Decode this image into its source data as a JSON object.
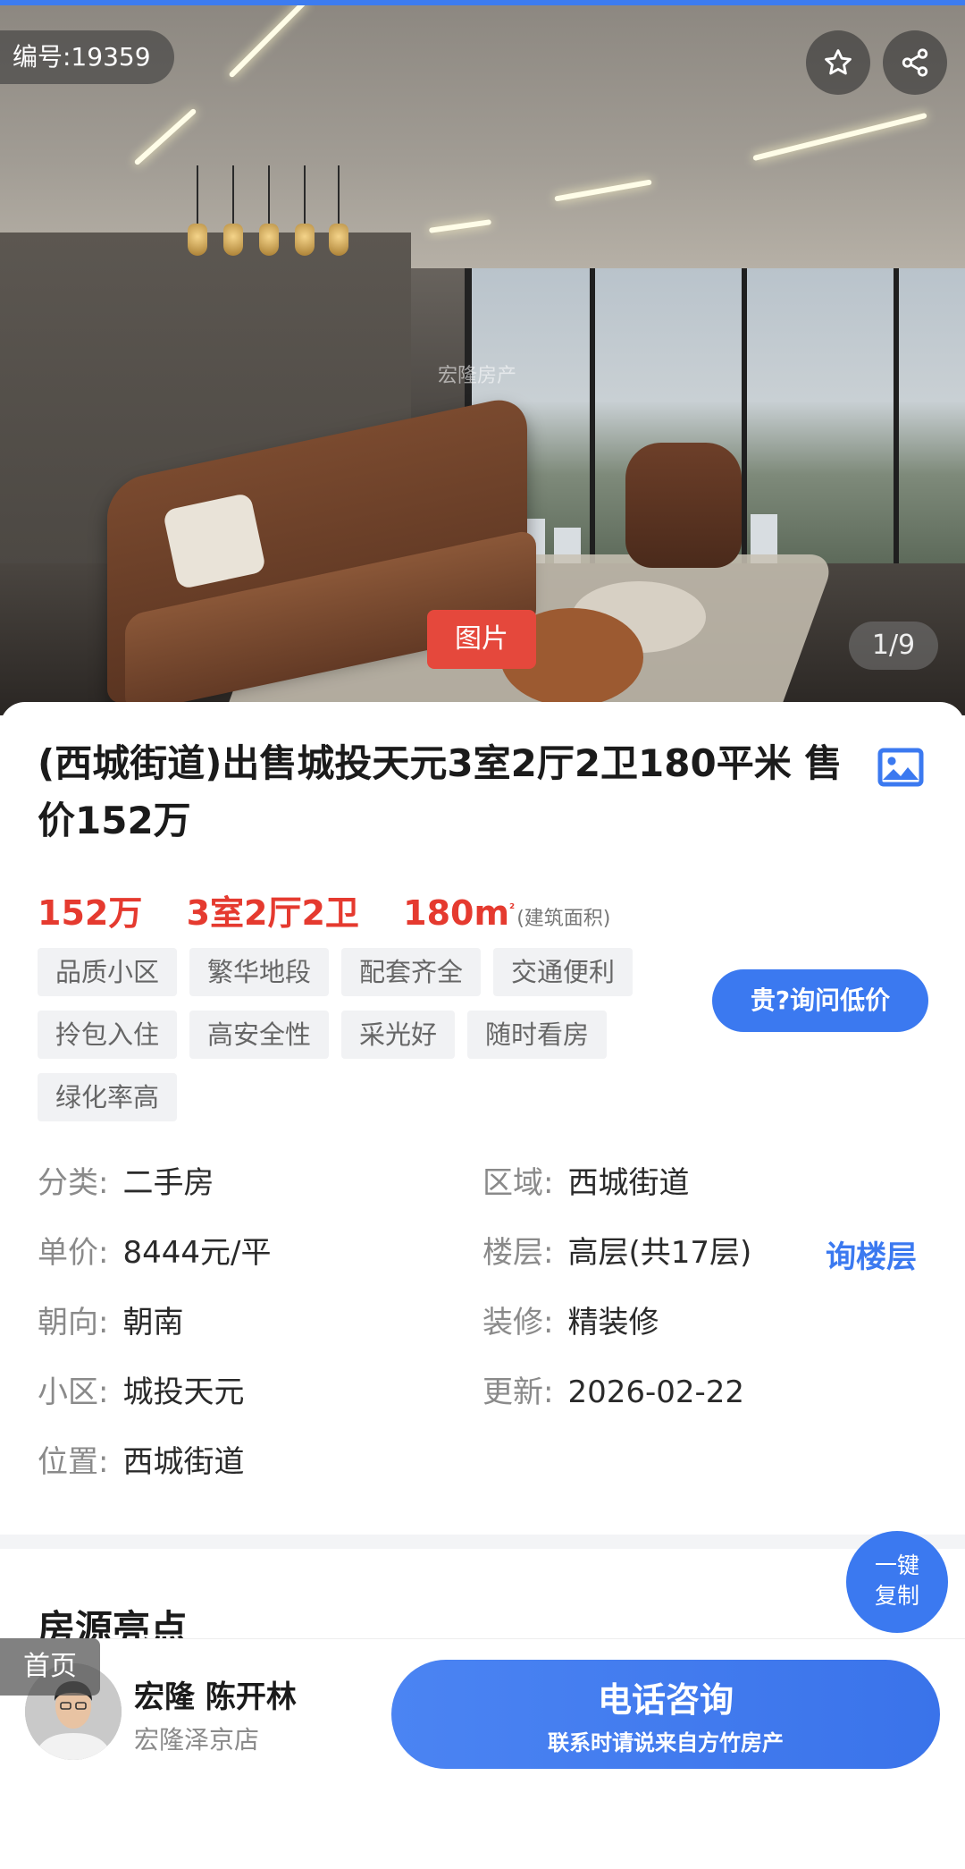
{
  "hero": {
    "listing_id": "编号:19359",
    "watermark": "宏隆房产",
    "photo_tab": "图片",
    "photo_counter": "1/9"
  },
  "listing": {
    "title": "(西城街道)出售城投天元3室2厅2卫180平米 售价152万",
    "price": "152万",
    "layout": "3室2厅2卫",
    "area": "180m",
    "area_sup": "²",
    "area_note": "(建筑面积)",
    "tags": [
      "品质小区",
      "繁华地段",
      "配套齐全",
      "交通便利",
      "拎包入住",
      "高安全性",
      "采光好",
      "随时看房",
      "绿化率高"
    ],
    "ask_price_label": "贵?询问低价"
  },
  "details": {
    "category": {
      "key": "分类:",
      "value": "二手房"
    },
    "district": {
      "key": "区域:",
      "value": "西城街道"
    },
    "unit_price": {
      "key": "单价:",
      "value": "8444元/平"
    },
    "floor": {
      "key": "楼层:",
      "value": "高层(共17层)"
    },
    "ask_floor_label": "询楼层",
    "orientation": {
      "key": "朝向:",
      "value": "朝南"
    },
    "decoration": {
      "key": "装修:",
      "value": "精装修"
    },
    "community": {
      "key": "小区:",
      "value": "城投天元"
    },
    "updated": {
      "key": "更新:",
      "value": "2026-02-22"
    },
    "location": {
      "key": "位置:",
      "value": "西城街道"
    }
  },
  "highlights": {
    "section_title": "房源亮点",
    "copy_label_1": "一键",
    "copy_label_2": "复制"
  },
  "bottom": {
    "home_label": "首页",
    "agent_name": "宏隆 陈开林",
    "agent_store": "宏隆泽京店",
    "call_label": "电话咨询",
    "call_sub": "联系时请说来自方竹房产"
  },
  "colors": {
    "accent_blue": "#3b79f0",
    "price_red": "#e53a2f",
    "tag_bg": "#f1f2f4"
  }
}
